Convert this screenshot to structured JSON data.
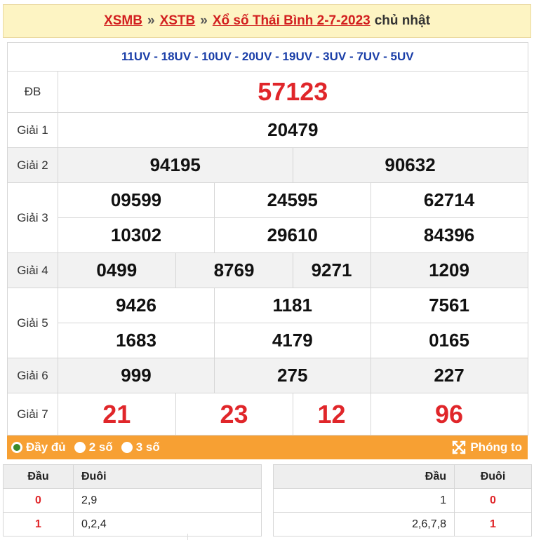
{
  "header": {
    "crumb1": "XSMB",
    "crumb2": "XSTB",
    "title": "Xổ số Thái Bình 2-7-2023",
    "day": "chủ nhật",
    "separator": "»"
  },
  "codes": "11UV - 18UV - 10UV - 20UV - 19UV - 3UV - 7UV - 5UV",
  "prizes": {
    "db": {
      "label": "ĐB",
      "values": [
        "57123"
      ]
    },
    "g1": {
      "label": "Giải 1",
      "values": [
        "20479"
      ]
    },
    "g2": {
      "label": "Giải 2",
      "values": [
        "94195",
        "90632"
      ]
    },
    "g3": {
      "label": "Giải 3",
      "values": [
        "09599",
        "24595",
        "62714",
        "10302",
        "29610",
        "84396"
      ]
    },
    "g4": {
      "label": "Giải 4",
      "values": [
        "0499",
        "8769",
        "9271",
        "1209"
      ]
    },
    "g5": {
      "label": "Giải 5",
      "values": [
        "9426",
        "1181",
        "7561",
        "1683",
        "4179",
        "0165"
      ]
    },
    "g6": {
      "label": "Giải 6",
      "values": [
        "999",
        "275",
        "227"
      ]
    },
    "g7": {
      "label": "Giải 7",
      "values": [
        "21",
        "23",
        "12",
        "96"
      ]
    }
  },
  "options": {
    "full": "Đầy đủ",
    "two": "2 số",
    "three": "3 số",
    "zoom": "Phóng to",
    "selected": "full"
  },
  "loto_left": {
    "headers": [
      "Đầu",
      "Đuôi"
    ],
    "rows": [
      {
        "dau": "0",
        "duoi": "2,9"
      },
      {
        "dau": "1",
        "duoi": "0,2,4"
      }
    ]
  },
  "loto_right": {
    "headers": [
      "Đầu",
      "Đuôi"
    ],
    "rows": [
      {
        "dau": "1",
        "duoi": "0"
      },
      {
        "dau": "2,6,7,8",
        "duoi": "1"
      }
    ]
  },
  "colors": {
    "accent_red": "#e0262a",
    "code_blue": "#1a3ea8",
    "bar_orange": "#f7a033",
    "header_bg": "#fdf4c3"
  }
}
